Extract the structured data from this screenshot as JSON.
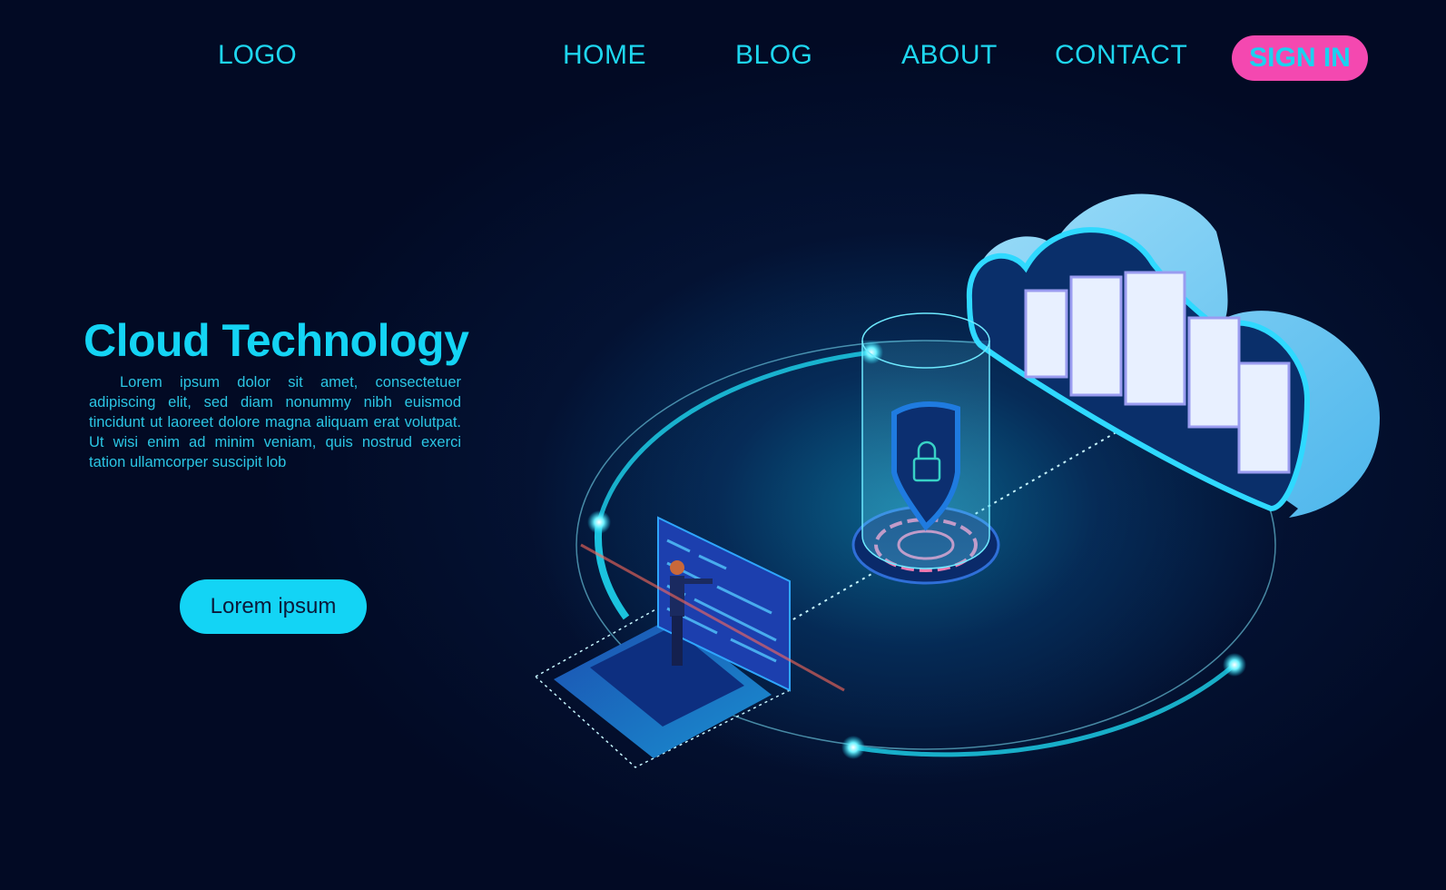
{
  "header": {
    "logo": "LOGO",
    "nav": [
      "HOME",
      "BLOG",
      "ABOUT",
      "CONTACT"
    ],
    "signin_label": "SIGN IN"
  },
  "hero": {
    "title": "Cloud Technology",
    "body": "Lorem ipsum dolor sit amet, consectetuer adipiscing elit, sed diam nonummy nibh euismod tincidunt ut laoreet dolore magna aliquam erat volutpat. Ut wisi enim ad minim veniam, quis nostrud exerci tation ullamcorper suscipit lob",
    "cta_label": "Lorem ipsum"
  },
  "illustration": {
    "elements": [
      "laptop-with-person",
      "security-shield-cylinder",
      "cloud-server",
      "network-ring"
    ]
  },
  "colors": {
    "background": "#020a24",
    "accent": "#14d4f4",
    "signin_bg": "#f448b0"
  }
}
